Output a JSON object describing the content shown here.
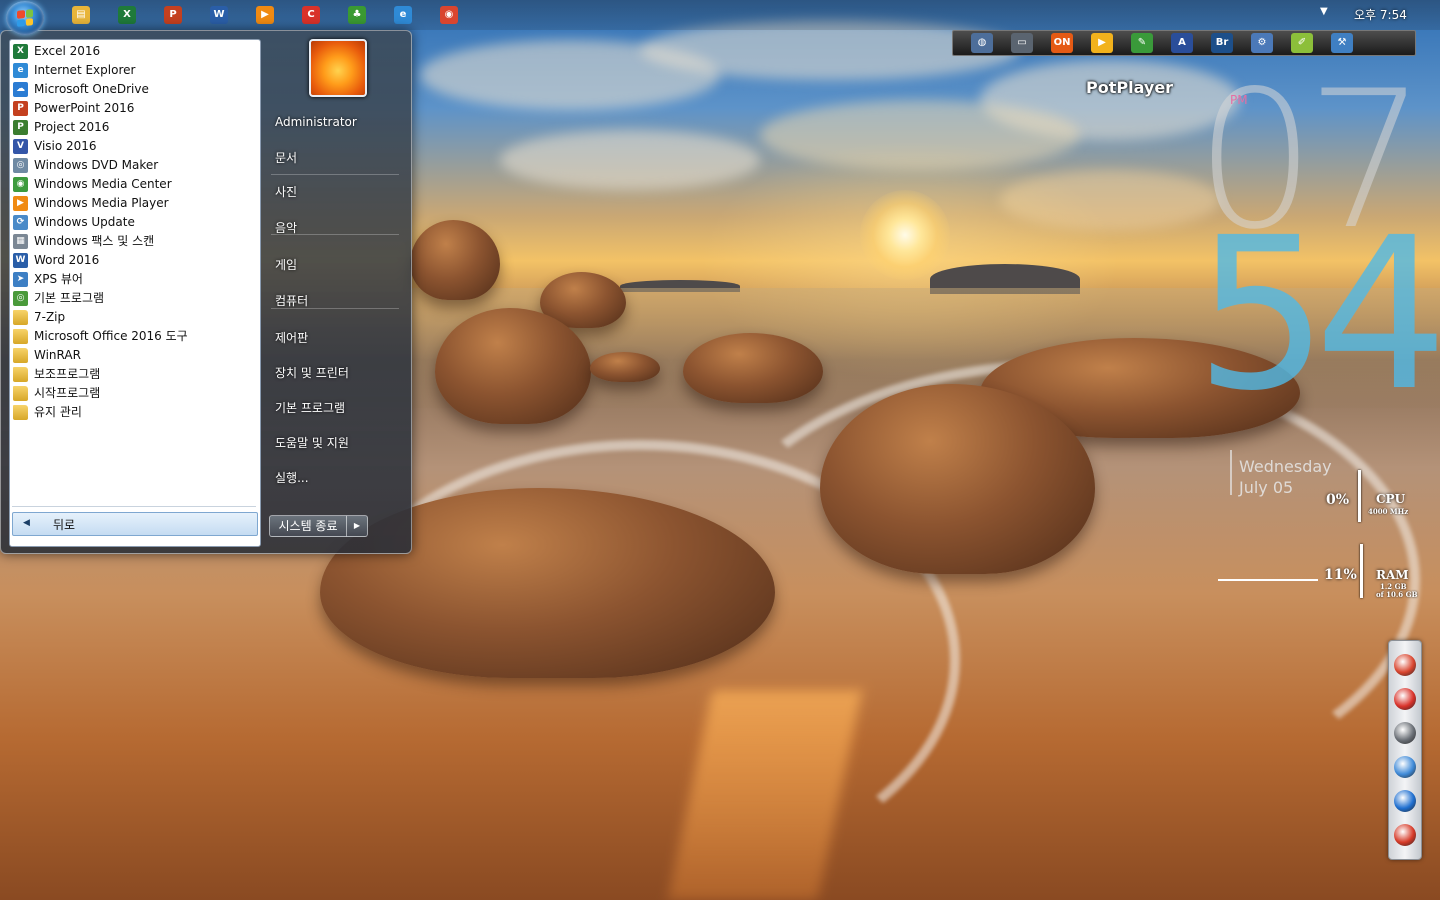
{
  "taskbar": {
    "pinned": [
      {
        "name": "explorer-icon",
        "color": "#e8b53a",
        "glyph": "▤"
      },
      {
        "name": "excel-icon",
        "color": "#1f7a3a",
        "glyph": "X"
      },
      {
        "name": "powerpoint-icon",
        "color": "#c4401f",
        "glyph": "P"
      },
      {
        "name": "word-icon",
        "color": "#2a5ea8",
        "glyph": "W"
      },
      {
        "name": "media-player-icon",
        "color": "#f08a12",
        "glyph": "▶"
      },
      {
        "name": "ccleaner-icon",
        "color": "#d9322a",
        "glyph": "C"
      },
      {
        "name": "clover-icon",
        "color": "#3a9a32",
        "glyph": "♣"
      },
      {
        "name": "internet-explorer-icon",
        "color": "#2f8ad6",
        "glyph": "e"
      },
      {
        "name": "chrome-icon",
        "color": "#d9452f",
        "glyph": "◉"
      }
    ],
    "clock": "오후 7:54"
  },
  "start_menu": {
    "programs": [
      {
        "label": "Excel 2016",
        "icon": "excel-icon",
        "color": "#1f7a3a",
        "glyph": "X"
      },
      {
        "label": "Internet Explorer",
        "icon": "internet-explorer-icon",
        "color": "#2f8ad6",
        "glyph": "e"
      },
      {
        "label": "Microsoft OneDrive",
        "icon": "onedrive-icon",
        "color": "#2b7cd3",
        "glyph": "☁"
      },
      {
        "label": "PowerPoint 2016",
        "icon": "powerpoint-icon",
        "color": "#c4401f",
        "glyph": "P"
      },
      {
        "label": "Project 2016",
        "icon": "project-icon",
        "color": "#3b7d2f",
        "glyph": "P"
      },
      {
        "label": "Visio 2016",
        "icon": "visio-icon",
        "color": "#3456a8",
        "glyph": "V"
      },
      {
        "label": "Windows DVD Maker",
        "icon": "dvd-maker-icon",
        "color": "#6f8aa3",
        "glyph": "◎"
      },
      {
        "label": "Windows Media Center",
        "icon": "media-center-icon",
        "color": "#3d9a3d",
        "glyph": "◉"
      },
      {
        "label": "Windows Media Player",
        "icon": "media-player-icon",
        "color": "#f08a12",
        "glyph": "▶"
      },
      {
        "label": "Windows Update",
        "icon": "windows-update-icon",
        "color": "#4a8ac8",
        "glyph": "⟳"
      },
      {
        "label": "Windows 팩스 및 스캔",
        "icon": "fax-scan-icon",
        "color": "#7b8794",
        "glyph": "▦"
      },
      {
        "label": "Word 2016",
        "icon": "word-icon",
        "color": "#2a5ea8",
        "glyph": "W"
      },
      {
        "label": "XPS 뷰어",
        "icon": "xps-viewer-icon",
        "color": "#3d7fc4",
        "glyph": "➤"
      },
      {
        "label": "기본 프로그램",
        "icon": "default-programs-icon",
        "color": "#4a9a3a",
        "glyph": "◎"
      },
      {
        "label": "7-Zip",
        "icon": "folder-icon",
        "folder": true
      },
      {
        "label": "Microsoft Office 2016 도구",
        "icon": "folder-icon",
        "folder": true
      },
      {
        "label": "WinRAR",
        "icon": "folder-icon",
        "folder": true
      },
      {
        "label": "보조프로그램",
        "icon": "folder-icon",
        "folder": true
      },
      {
        "label": "시작프로그램",
        "icon": "folder-icon",
        "folder": true
      },
      {
        "label": "유지 관리",
        "icon": "folder-icon",
        "folder": true
      }
    ],
    "back_label": "뒤로",
    "right_items": [
      {
        "label": "Administrator",
        "name": "right-item-administrator"
      },
      {
        "label": "문서",
        "name": "right-item-documents"
      },
      {
        "label": "사진",
        "name": "right-item-pictures"
      },
      {
        "label": "음악",
        "name": "right-item-music"
      },
      {
        "label": "게임",
        "name": "right-item-games"
      },
      {
        "label": "컴퓨터",
        "name": "right-item-computer"
      },
      {
        "label": "제어판",
        "name": "right-item-control-panel"
      },
      {
        "label": "장치 및 프린터",
        "name": "right-item-devices-printers"
      },
      {
        "label": "기본 프로그램",
        "name": "right-item-default-programs"
      },
      {
        "label": "도움말 및 지원",
        "name": "right-item-help-support"
      },
      {
        "label": "실행...",
        "name": "right-item-run"
      }
    ],
    "shutdown_label": "시스템 종료"
  },
  "dock": {
    "label": "PotPlayer",
    "items": [
      {
        "name": "globe-icon",
        "color": "#4d6e9a",
        "glyph": "◍"
      },
      {
        "name": "monitor-icon",
        "color": "#5a6470",
        "glyph": "▭"
      },
      {
        "name": "on-icon",
        "color": "#e55a14",
        "glyph": "ON"
      },
      {
        "name": "potplayer-icon",
        "color": "#f2b21c",
        "glyph": "▶"
      },
      {
        "name": "paint-icon",
        "color": "#3a9a3a",
        "glyph": "✎"
      },
      {
        "name": "font-icon",
        "color": "#2a4e9a",
        "glyph": "A"
      },
      {
        "name": "bridge-icon",
        "color": "#1d4f8a",
        "glyph": "Br"
      },
      {
        "name": "network-icon",
        "color": "#4b79b8",
        "glyph": "⚙"
      },
      {
        "name": "notepad-icon",
        "color": "#8cbf3a",
        "glyph": "✐"
      },
      {
        "name": "tools-icon",
        "color": "#3f7fc2",
        "glyph": "⚒"
      }
    ]
  },
  "clock_widget": {
    "ampm": "PM",
    "hour": "07",
    "minute": "54",
    "day": "Wednesday",
    "date": "July  05"
  },
  "meters": {
    "cpu": {
      "percent_text": "0%",
      "label": "CPU",
      "sub": "4000 MHz"
    },
    "ram": {
      "percent_text": "11%",
      "label": "RAM",
      "sub1": "1.2 GB",
      "sub2": "of 10.6 GB"
    }
  },
  "side_dock": [
    {
      "name": "chrome-icon",
      "color": "#d9452f"
    },
    {
      "name": "ccleaner-icon",
      "color": "#d9322a"
    },
    {
      "name": "diamond-icon",
      "color": "#6a6f76"
    },
    {
      "name": "photo-icon",
      "color": "#3f8ad8"
    },
    {
      "name": "browser-icon",
      "color": "#1f6fd0"
    },
    {
      "name": "power-icon",
      "color": "#d63a28"
    }
  ]
}
